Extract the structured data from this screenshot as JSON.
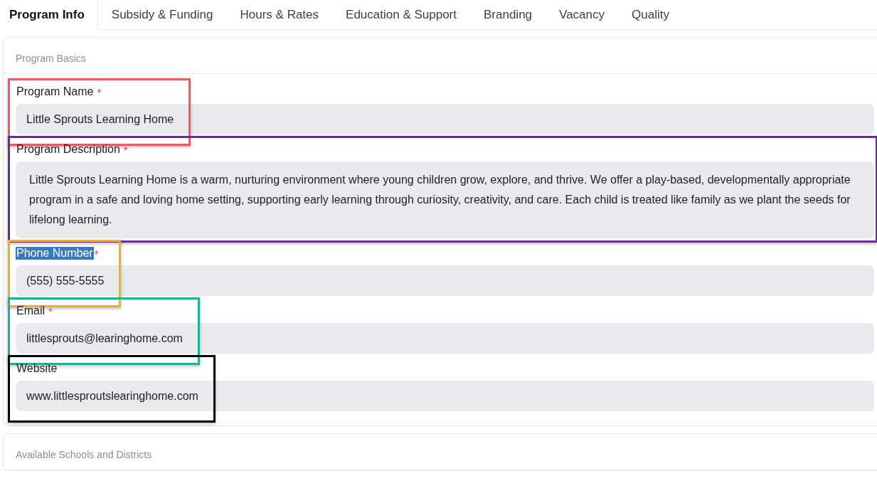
{
  "tabs": [
    {
      "label": "Program Info",
      "selected": true
    },
    {
      "label": "Subsidy & Funding",
      "selected": false
    },
    {
      "label": "Hours & Rates",
      "selected": false
    },
    {
      "label": "Education & Support",
      "selected": false
    },
    {
      "label": "Branding",
      "selected": false
    },
    {
      "label": "Vacancy",
      "selected": false
    },
    {
      "label": "Quality",
      "selected": false
    }
  ],
  "sections": [
    {
      "title": "Program Basics",
      "fields": [
        {
          "kind": "input",
          "label": "Program Name",
          "required_mark": "*",
          "highlighted": false,
          "value": "Little Sprouts Learning Home",
          "color": "#f05a5a"
        },
        {
          "kind": "textarea",
          "label": "Program Description",
          "required_mark": "*",
          "highlighted": false,
          "value": "Little Sprouts Learning Home is a warm, nurturing environment where young children grow, explore, and thrive. We offer a play-based, developmentally appropriate program in a safe and loving home setting, supporting early learning through curiosity, creativity, and care. Each child is treated like family as we plant the seeds for lifelong learning.",
          "color": "#6a2c91"
        },
        {
          "kind": "input",
          "label": "Phone Number",
          "required_mark": "*",
          "highlighted": true,
          "value": "(555) 555-5555",
          "color": "#f5b014"
        },
        {
          "kind": "input",
          "label": "Email",
          "required_mark": "*",
          "highlighted": false,
          "value": "littlesprouts@learinghome.com",
          "color": "#1ab394"
        },
        {
          "kind": "input",
          "label": "Website",
          "highlighted": false,
          "value": "www.littlesproutslearinghome.com",
          "color": "#000000"
        }
      ]
    },
    {
      "title": "Available Schools and Districts"
    }
  ]
}
